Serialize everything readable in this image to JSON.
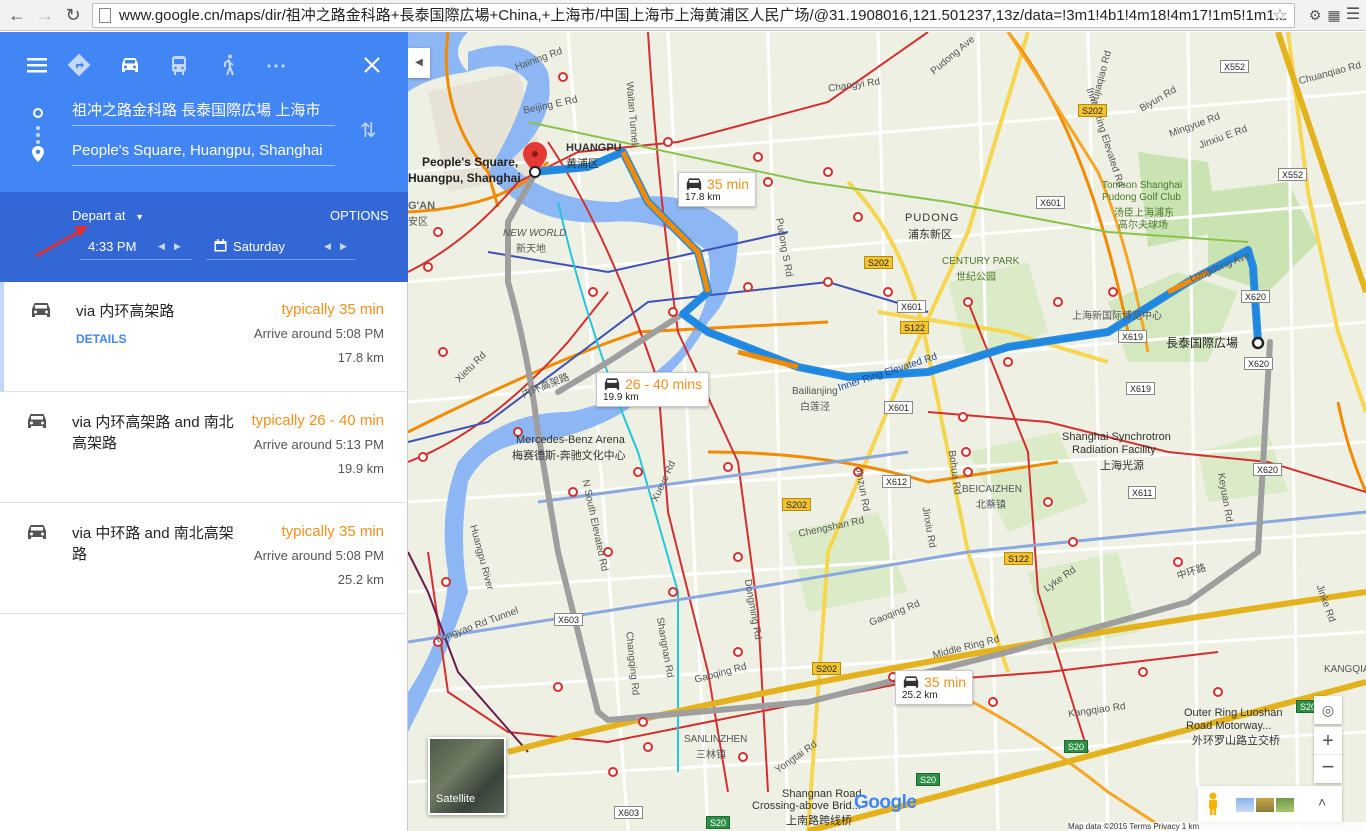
{
  "browser": {
    "url": "www.google.cn/maps/dir/祖冲之路金科路+長泰国際広場+China,+上海市/中国上海市上海黄浦区人民广场/@31.1908016,121.501237,13z/data=!3m1!4b1!4m18!4m17!1m5!1m1..."
  },
  "directions": {
    "origin": "祖冲之路金科路 長泰国際広場 上海市",
    "destination": "People's Square, Huangpu, Shanghai",
    "depart_label": "Depart at",
    "options_label": "OPTIONS",
    "time": "4:33 PM",
    "day": "Saturday"
  },
  "routes": [
    {
      "via": "via 内环高架路",
      "time": "typically 35 min",
      "arrive": "Arrive around 5:08 PM",
      "dist": "17.8 km",
      "details": "DETAILS"
    },
    {
      "via": "via 内环高架路 and 南北高架路",
      "time": "typically 26 - 40 min",
      "arrive": "Arrive around 5:13 PM",
      "dist": "19.9 km"
    },
    {
      "via": "via 中环路 and 南北高架路",
      "time": "typically 35 min",
      "arrive": "Arrive around 5:08 PM",
      "dist": "25.2 km"
    }
  ],
  "map": {
    "bubble1": {
      "time": "35 min",
      "dist": "17.8 km"
    },
    "bubble2": {
      "time": "26 - 40 mins",
      "dist": "19.9 km"
    },
    "bubble3": {
      "time": "35 min",
      "dist": "25.2 km"
    },
    "dest_label_1": "People's Square,",
    "dest_label_2": "Huangpu, Shanghai",
    "origin_label": "長泰国際広場",
    "satellite_label": "Satellite",
    "google": "Google",
    "footer": "Map data ©2015    Terms    Privacy    1 km",
    "labels": {
      "haining": "Haining Rd",
      "beijing": "Beijing E Rd",
      "waitan": "Waitan Tunnel",
      "huangpu": "HUANGPU",
      "huangpu_cn": "黄浦区",
      "xintiandi_en": "NEW WORLD",
      "xintiandi_cn": "新天地",
      "gan": "G'AN",
      "gan_cn": "安区",
      "pudong": "PUDONG",
      "pudong_cn": "浦东新区",
      "century_park": "CENTURY PARK",
      "century_park_cn": "世纪公园",
      "tomson1": "Tomson Shanghai",
      "tomson2": "Pudong Golf Club",
      "tomson3": "汤臣上海浦东",
      "tomson4": "高尔夫球场",
      "newexpo": "上海新国际博览中心",
      "bailianjing": "Bailianjing",
      "bailianjing_cn": "白莲泾",
      "mercedes1": "Mercedes-Benz Arena",
      "mercedes2": "梅赛德斯-奔驰文化中心",
      "synchrotron1": "Shanghai Synchrotron",
      "synchrotron2": "Radiation Facility",
      "synchrotron3": "上海光源",
      "beicai": "BEICAIZHEN",
      "beicai_cn": "北蔡镇",
      "chengshan": "Chengshan Rd",
      "sanlin": "SANLINZHEN",
      "sanlin_cn": "三林镇",
      "gaoqing": "Gaoqing Rd",
      "middle_ring": "Middle Ring Rd",
      "zhonghuan_cn": "中环路",
      "kangqiao": "Kangqiao Rd",
      "outer_ring1": "Outer Ring Luoshan",
      "outer_ring2": "Road Motorway...",
      "outer_ring3": "外环罗山路立交桥",
      "shangnan1": "Shangnan Road",
      "shangnan2": "Crossing-above Brid...",
      "shangnan3": "上南路跨线桥",
      "inner_ring": "Inner Ring Elevated Rd",
      "inner_ring2": "Inner Ring Elevated Rd",
      "neihuan_cn": "内环高架路",
      "huangpu_river": "Huangpu River",
      "longyao": "Longyao Rd Tunnel",
      "longdong": "Longdong Ave",
      "changyi": "Changyi Rd",
      "pudong_ave": "Pudong Ave",
      "biyun": "Biyun Rd",
      "mingyue": "Mingyue Rd",
      "jinxiu": "Jinxiu E Rd",
      "jujiaqiao": "Jujiaqiao Rd",
      "chuangiao": "Chuanqiao Rd",
      "xietu": "Xietu Rd",
      "xueye": "Xueye Rd",
      "shangnan_rd": "Shangnan Rd",
      "lingyan": "Lingyan S Rd",
      "changqing": "Changqing Rd",
      "dongming": "Dongming Rd",
      "jinzun": "Jinzun Rd",
      "jinxiu_rd": "Jinxiu Rd",
      "bohua": "Bohua Rd",
      "yongtai": "Yongtai Rd",
      "lyke": "Lyke Rd",
      "jinke": "Jinke Rd",
      "keyuan": "Keyuan Rd",
      "kangqiao2": "KANGQIA",
      "pudong_s": "Pudong S Rd",
      "nanbei": "N South Elevated Rd"
    },
    "shields": [
      "X552",
      "X552",
      "S202",
      "X601",
      "S202",
      "X601",
      "S122",
      "X620",
      "X619",
      "X619",
      "X620",
      "X601",
      "X620",
      "X612",
      "X611",
      "S202",
      "S122",
      "X603",
      "S202",
      "S20",
      "S20",
      "S20",
      "X603",
      "S20"
    ]
  }
}
